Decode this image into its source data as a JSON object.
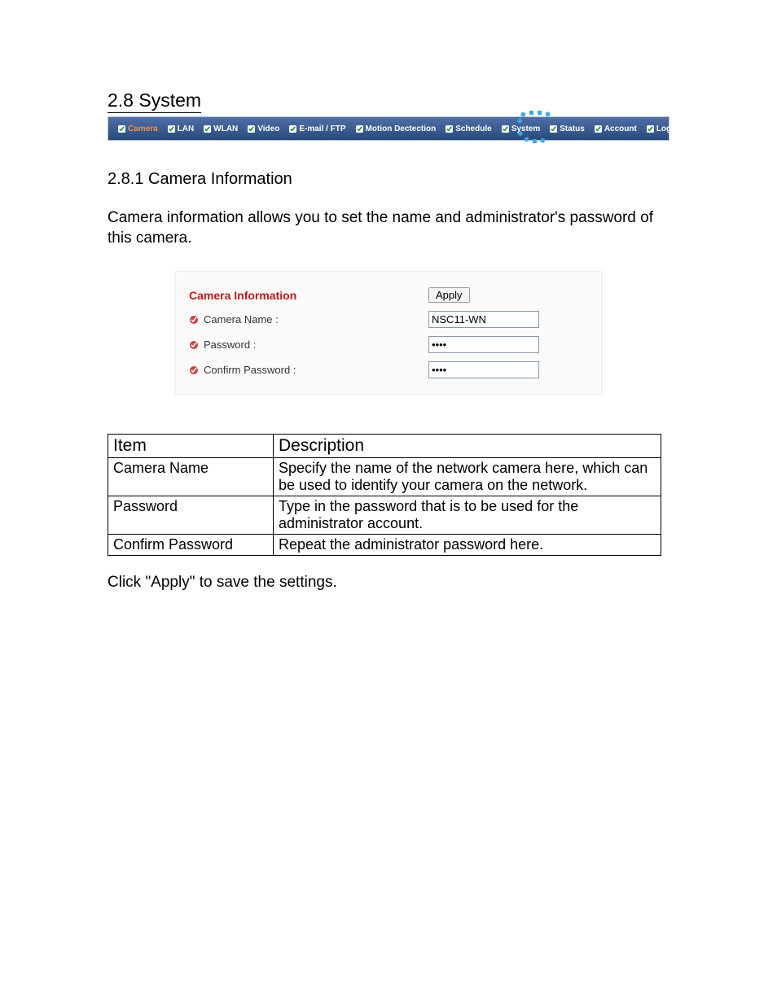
{
  "headings": {
    "section": "2.8 System",
    "subsection": "2.8.1 Camera Information"
  },
  "nav": {
    "items": [
      {
        "label": "Camera",
        "active": true
      },
      {
        "label": "LAN"
      },
      {
        "label": "WLAN",
        "active": false
      },
      {
        "label": "Video"
      },
      {
        "label": "E-mail / FTP"
      },
      {
        "label": "Motion Dectection"
      },
      {
        "label": "Schedule"
      },
      {
        "label": "System",
        "highlight": true
      },
      {
        "label": "Status"
      },
      {
        "label": "Account"
      },
      {
        "label": "Log"
      }
    ]
  },
  "intro": "Camera information allows you to set the name and administrator's password of this camera.",
  "panel": {
    "title": "Camera Information",
    "apply_label": "Apply",
    "fields": {
      "camera_name": {
        "label": "Camera Name :",
        "value": "NSC11-WN"
      },
      "password": {
        "label": "Password :",
        "value": "1234"
      },
      "confirm_password": {
        "label": "Confirm Password :",
        "value": "1234"
      }
    }
  },
  "table": {
    "headers": {
      "item": "Item",
      "description": "Description"
    },
    "rows": [
      {
        "item": "Camera Name",
        "description": "Specify the name of the network camera here, which can be used to identify your camera on the network."
      },
      {
        "item": "Password",
        "description": "Type in the password that is to be used for the administrator account."
      },
      {
        "item": "Confirm Password",
        "description": "Repeat the administrator password here."
      }
    ]
  },
  "footer": "Click \"Apply\" to save the settings."
}
